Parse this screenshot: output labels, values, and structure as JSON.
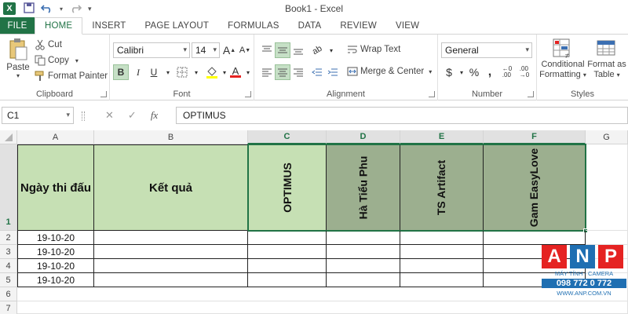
{
  "window": {
    "title": "Book1 - Excel",
    "app_logo": "X"
  },
  "qat": {
    "save_icon": "save-icon",
    "undo_icon": "undo-icon",
    "redo_icon": "redo-icon"
  },
  "tabs": [
    {
      "label": "FILE"
    },
    {
      "label": "HOME"
    },
    {
      "label": "INSERT"
    },
    {
      "label": "PAGE LAYOUT"
    },
    {
      "label": "FORMULAS"
    },
    {
      "label": "DATA"
    },
    {
      "label": "REVIEW"
    },
    {
      "label": "VIEW"
    }
  ],
  "ribbon": {
    "clipboard": {
      "label": "Clipboard",
      "paste": "Paste",
      "cut": "Cut",
      "copy": "Copy",
      "format_painter": "Format Painter"
    },
    "font": {
      "label": "Font",
      "font_name": "Calibri",
      "font_size": "14",
      "bold": "B",
      "italic": "I",
      "underline": "U"
    },
    "alignment": {
      "label": "Alignment",
      "wrap_text": "Wrap Text",
      "merge_center": "Merge & Center"
    },
    "number": {
      "label": "Number",
      "format": "General",
      "currency": "$",
      "percent": "%",
      "comma": ","
    },
    "styles": {
      "label": "Styles",
      "conditional": "Conditional",
      "formatting": "Formatting",
      "format_as": "Format as",
      "table": "Table"
    }
  },
  "formula_bar": {
    "name_box": "C1",
    "cancel": "✕",
    "enter": "✓",
    "fx": "fx",
    "formula": "OPTIMUS"
  },
  "columns": [
    "A",
    "B",
    "C",
    "D",
    "E",
    "F",
    "G"
  ],
  "rows": [
    "1",
    "2",
    "3",
    "4",
    "5",
    "6",
    "7"
  ],
  "sheet": {
    "header": {
      "a1": "Ngày thi đấu",
      "b1": "Kết quả",
      "c1": "OPTIMUS",
      "d1": "Hà Tiểu Phu",
      "e1": "TS Artifact",
      "f1": "Gam EasyLove"
    },
    "dates": [
      "19-10-20",
      "19-10-20",
      "19-10-20",
      "19-10-20"
    ]
  },
  "watermark": {
    "a": "A",
    "n": "N",
    "p": "P",
    "sub": "MÁY TÍNH - CAMERA",
    "phone": "098 772 0 772",
    "url": "WWW.ANP.COM.VN"
  },
  "colors": {
    "excel_green": "#217346",
    "cell_light": "#c6e0b4",
    "cell_dark": "#9caf8f",
    "anp_red": "#e52322",
    "anp_blue": "#1f6fb2"
  }
}
